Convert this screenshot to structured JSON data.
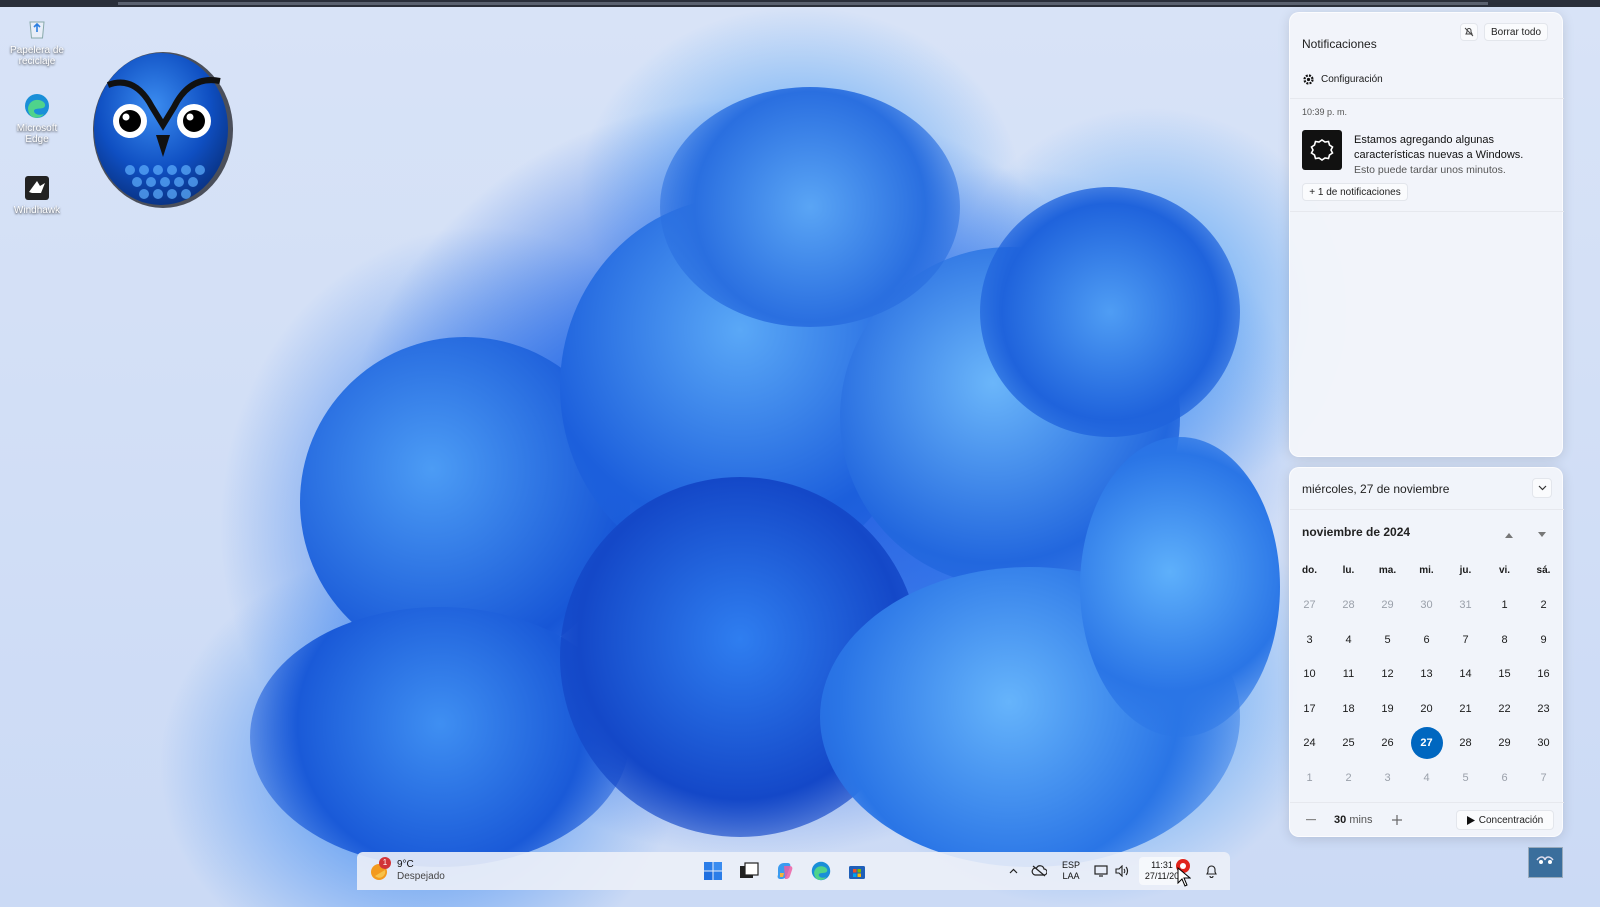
{
  "desktop": {
    "icons": [
      {
        "label": "Papelera de reciclaje",
        "icon": "recycle-bin-icon"
      },
      {
        "label": "Microsoft Edge",
        "icon": "edge-icon"
      },
      {
        "label": "Windhawk",
        "icon": "windhawk-icon"
      }
    ]
  },
  "notifications": {
    "title": "Notificaciones",
    "clear_all": "Borrar todo",
    "settings": "Configuración",
    "time": "10:39 p. m.",
    "message_title": "Estamos agregando algunas características nuevas a Windows.",
    "message_sub": "Esto puede tardar unos minutos.",
    "more": "+ 1 de notificaciones"
  },
  "calendar": {
    "date_header": "miércoles, 27 de noviembre",
    "month_title": "noviembre de 2024",
    "weekdays": [
      "do.",
      "lu.",
      "ma.",
      "mi.",
      "ju.",
      "vi.",
      "sá."
    ],
    "weeks": [
      [
        "27",
        "28",
        "29",
        "30",
        "31",
        "1",
        "2"
      ],
      [
        "3",
        "4",
        "5",
        "6",
        "7",
        "8",
        "9"
      ],
      [
        "10",
        "11",
        "12",
        "13",
        "14",
        "15",
        "16"
      ],
      [
        "17",
        "18",
        "19",
        "20",
        "21",
        "22",
        "23"
      ],
      [
        "24",
        "25",
        "26",
        "27",
        "28",
        "29",
        "30"
      ],
      [
        "1",
        "2",
        "3",
        "4",
        "5",
        "6",
        "7"
      ]
    ],
    "today": "27",
    "focus_minutes": "30",
    "focus_unit": "mins",
    "focus_label": "Concentración"
  },
  "taskbar": {
    "weather_temp": "9°C",
    "weather_desc": "Despejado",
    "weather_badge": "1",
    "lang_top": "ESP",
    "lang_bottom": "LAA",
    "clock_time": "11:31",
    "clock_date": "27/11/20"
  },
  "colors": {
    "accent": "#0067c0",
    "wallpaper_blue": "#1f6fe6"
  }
}
